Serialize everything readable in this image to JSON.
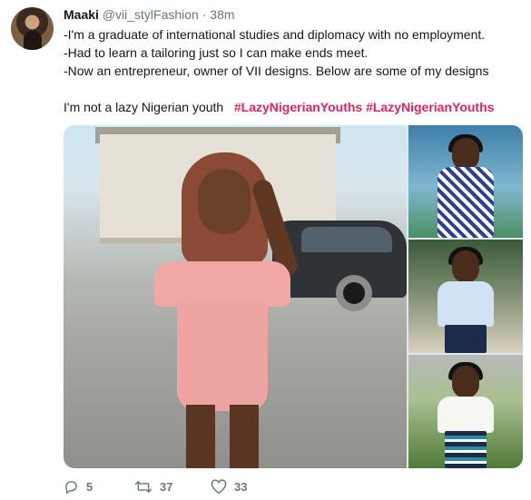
{
  "tweet": {
    "author_name": "Maaki",
    "author_handle": "@vii_stylFashion",
    "separator": "·",
    "time": "38m",
    "lines": [
      "-I'm a graduate of international studies and diplomacy with no employment.",
      "-Had to learn a tailoring just so I can make ends meet.",
      "-Now an entrepreneur, owner of VII designs. Below are some of my designs"
    ],
    "closing_text": "I'm not a lazy Nigerian youth",
    "hashtags": [
      "#LazyNigerianYouths",
      "#LazyNigerianYouths"
    ]
  },
  "actions": {
    "reply_icon": "reply-icon",
    "reply_count": "5",
    "retweet_icon": "retweet-icon",
    "retweet_count": "37",
    "like_icon": "heart-icon",
    "like_count": "33"
  },
  "colors": {
    "hashtag": "#e0245e",
    "muted": "#657786",
    "text": "#14171a"
  }
}
